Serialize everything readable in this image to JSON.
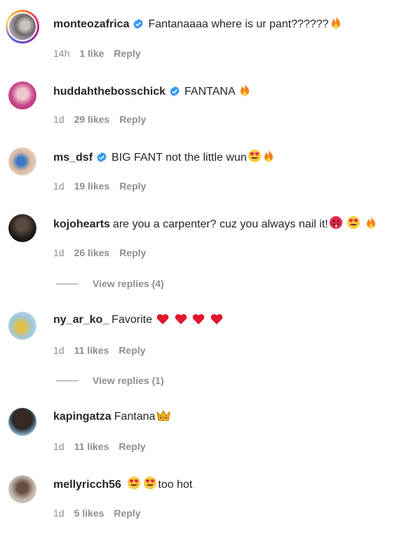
{
  "colors": {
    "verified": "#3897f0",
    "meta": "#8e8e8e",
    "text": "#262626"
  },
  "comments": [
    {
      "username": "monteozafrica",
      "verified": true,
      "text": "Fantanaaaa where is ur pant??????",
      "emojis": [
        "fire"
      ],
      "time": "14h",
      "likes": "1 like",
      "reply": "Reply",
      "story_ring": true
    },
    {
      "username": "huddahthebosschick",
      "verified": true,
      "text": "FANTANA",
      "emojis": [
        "fire"
      ],
      "time": "1d",
      "likes": "29 likes",
      "reply": "Reply"
    },
    {
      "username": "ms_dsf",
      "verified": true,
      "text": "BIG FANT not the little wun",
      "emojis": [
        "heart-eyes",
        "fire"
      ],
      "time": "1d",
      "likes": "19 likes",
      "reply": "Reply"
    },
    {
      "username": "kojohearts",
      "verified": false,
      "text": "are you a carpenter? cuz you always nail it!",
      "emojis": [
        "tongue-face",
        "heart-eyes",
        "fire"
      ],
      "time": "1d",
      "likes": "26 likes",
      "reply": "Reply",
      "view_replies": "View replies (4)"
    },
    {
      "username": "ny_ar_ko_",
      "verified": false,
      "text": "Favorite",
      "emojis": [
        "heart",
        "heart",
        "heart",
        "heart"
      ],
      "time": "1d",
      "likes": "11 likes",
      "reply": "Reply",
      "view_replies": "View replies (1)"
    },
    {
      "username": "kapingatza",
      "verified": false,
      "text": "Fantana",
      "emojis": [
        "crown"
      ],
      "time": "1d",
      "likes": "11 likes",
      "reply": "Reply"
    },
    {
      "username": "mellyricch56",
      "verified": false,
      "text_before_emojis": true,
      "text": "too hot",
      "emojis": [
        "heart-eyes",
        "heart-eyes"
      ],
      "time": "1d",
      "likes": "5 likes",
      "reply": "Reply"
    }
  ]
}
